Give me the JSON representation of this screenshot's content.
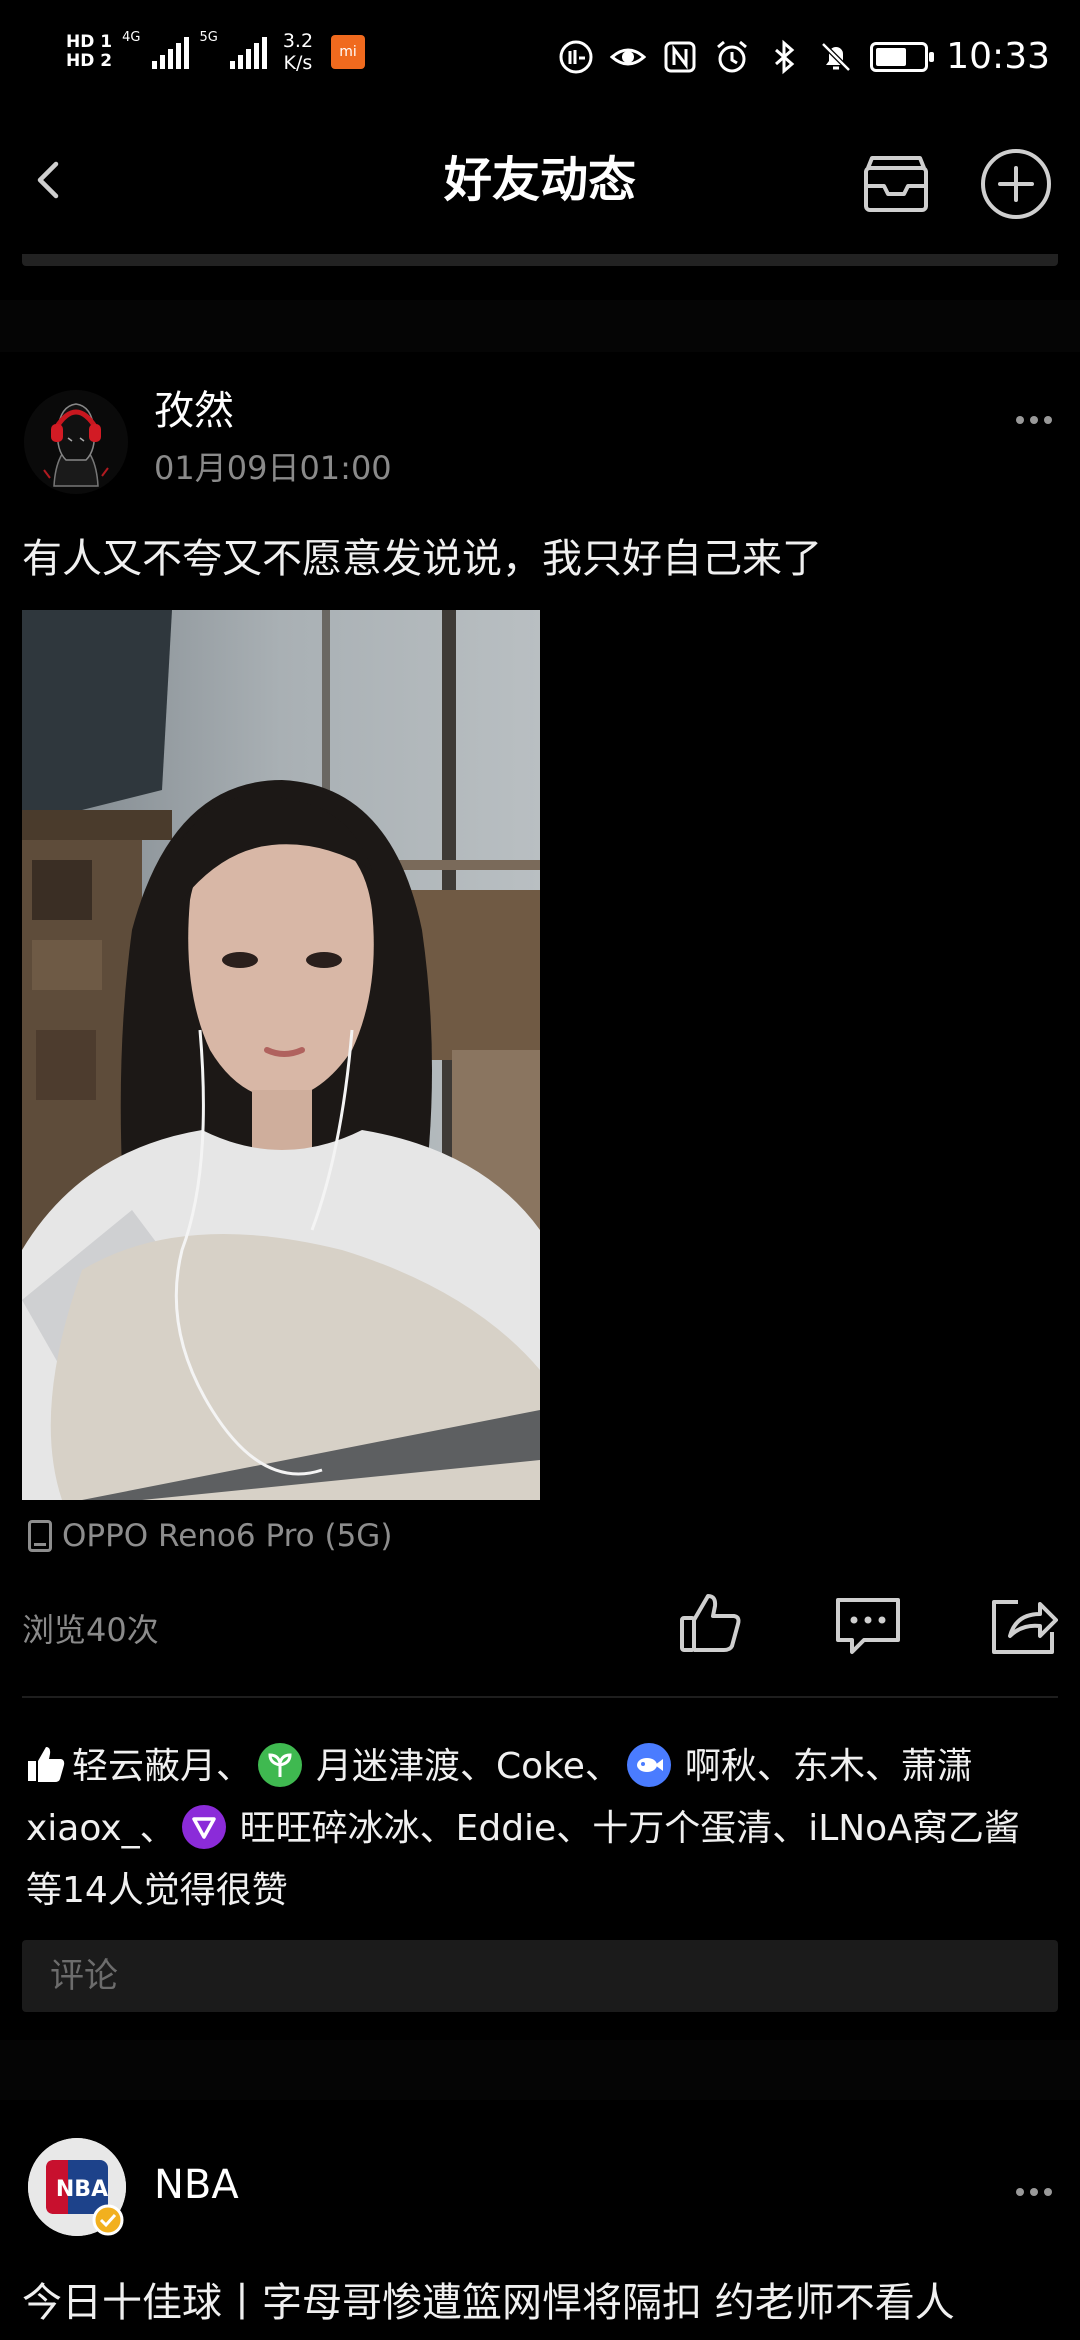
{
  "status_bar": {
    "hd1": "HD 1",
    "hd2": "HD 2",
    "net1": "4G",
    "net2": "5G",
    "speed_value": "3.2",
    "speed_unit": "K/s",
    "time": "10:33",
    "battery_level": 0.65,
    "icons": [
      "hd-icon",
      "signal-4g-icon",
      "signal-5g-icon",
      "mi-app-icon",
      "nfc-11-icon",
      "eye-icon",
      "nfc-icon",
      "alarm-icon",
      "bluetooth-icon",
      "mute-bell-icon",
      "battery-icon"
    ]
  },
  "header": {
    "title": "好友动态",
    "back_icon": "chevron-left-icon",
    "inbox_icon": "inbox-icon",
    "add_icon": "plus-circle-icon"
  },
  "post": {
    "username": "孜然",
    "time": "01月09日01:00",
    "text": "有人又不夸又不愿意发说说，我只好自己来了",
    "device": "OPPO Reno6 Pro (5G)",
    "views": "浏览40次",
    "likes": {
      "part1": "轻云蔽月、",
      "part2": "月迷津渡、Coke、",
      "part3": "啊秋、东木、萧潇",
      "part4": "xiaox_、",
      "part5": "旺旺碎冰冰、Eddie、十万个蛋清、iLNoA窝乙酱",
      "part6": "等14人觉得很赞"
    },
    "comment_placeholder": "评论"
  },
  "next_post": {
    "username": "NBA",
    "avatar_text": "NBA",
    "text": "今日十佳球丨字母哥惨遭篮网悍将隔扣 约老师不看人"
  },
  "colors": {
    "background": "#000000",
    "secondary_text": "#8a8a8a",
    "orange_badge": "#f06a1e",
    "green_badge": "#3fb950",
    "blue_badge": "#4a7cff",
    "purple_badge": "#8b2bd9"
  }
}
